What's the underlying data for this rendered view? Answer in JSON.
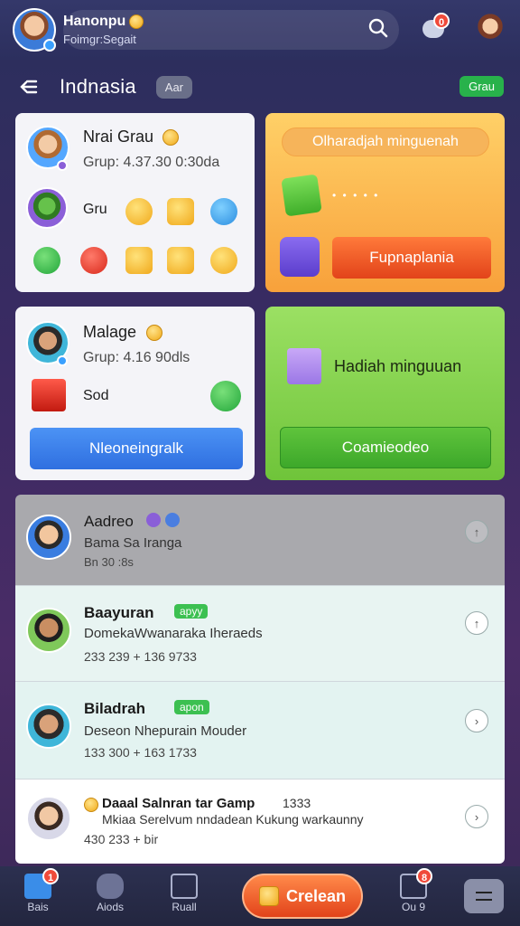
{
  "topbar": {
    "username": "Hanonpu",
    "subtitle": "Foimgr:Segait",
    "notification_count": "0"
  },
  "header": {
    "title": "Indnasia",
    "chip": "Aar",
    "right_chip": "Grau"
  },
  "card_group1": {
    "name": "Nrai Grau",
    "meta": "Grup: 4.37.30 0:30da",
    "row_label": "Gru"
  },
  "card_promo": {
    "pill": "Olharadjah minguenah",
    "dots": "• • • • •",
    "button": "Fupnaplania"
  },
  "card_group2": {
    "name": "Malage",
    "meta": "Grup: 4.16 90dls",
    "row_label": "Sod",
    "button": "Nleoneingralk"
  },
  "card_weekly": {
    "title": "Hadiah minguuan",
    "button": "Coamieodeo"
  },
  "list": [
    {
      "name": "Aadreo",
      "desc": "Bama Sa Iranga",
      "meta": "Bn 30 :8s",
      "tag": ""
    },
    {
      "name": "Baayuran",
      "desc": "DomekaWwanaraka Iheraeds",
      "meta": "233 239 +   136 9733",
      "tag": "apyy"
    },
    {
      "name": "Biladrah",
      "desc": "Deseon Nhepurain Mouder",
      "meta": "133 300 +   163 1733",
      "tag": "apon"
    },
    {
      "name": "Daaal Salnran tar Gamp",
      "desc": "Mkiaa Serelvum nndadean Kukung warkaunny",
      "meta": "430 233 +  bir",
      "tag": "",
      "extra": "1333"
    }
  ],
  "bottom_nav": {
    "home": "Bais",
    "home_badge": "1",
    "aids": "Aiods",
    "ruall": "Ruall",
    "cta": "Crelean",
    "ou": "Ou 9",
    "ou_badge": "8"
  },
  "colors": {
    "orange_card": "#f8a13b",
    "green_card": "#6fc43a",
    "blue_button": "#3b82f0",
    "cta": "#e2431a"
  }
}
